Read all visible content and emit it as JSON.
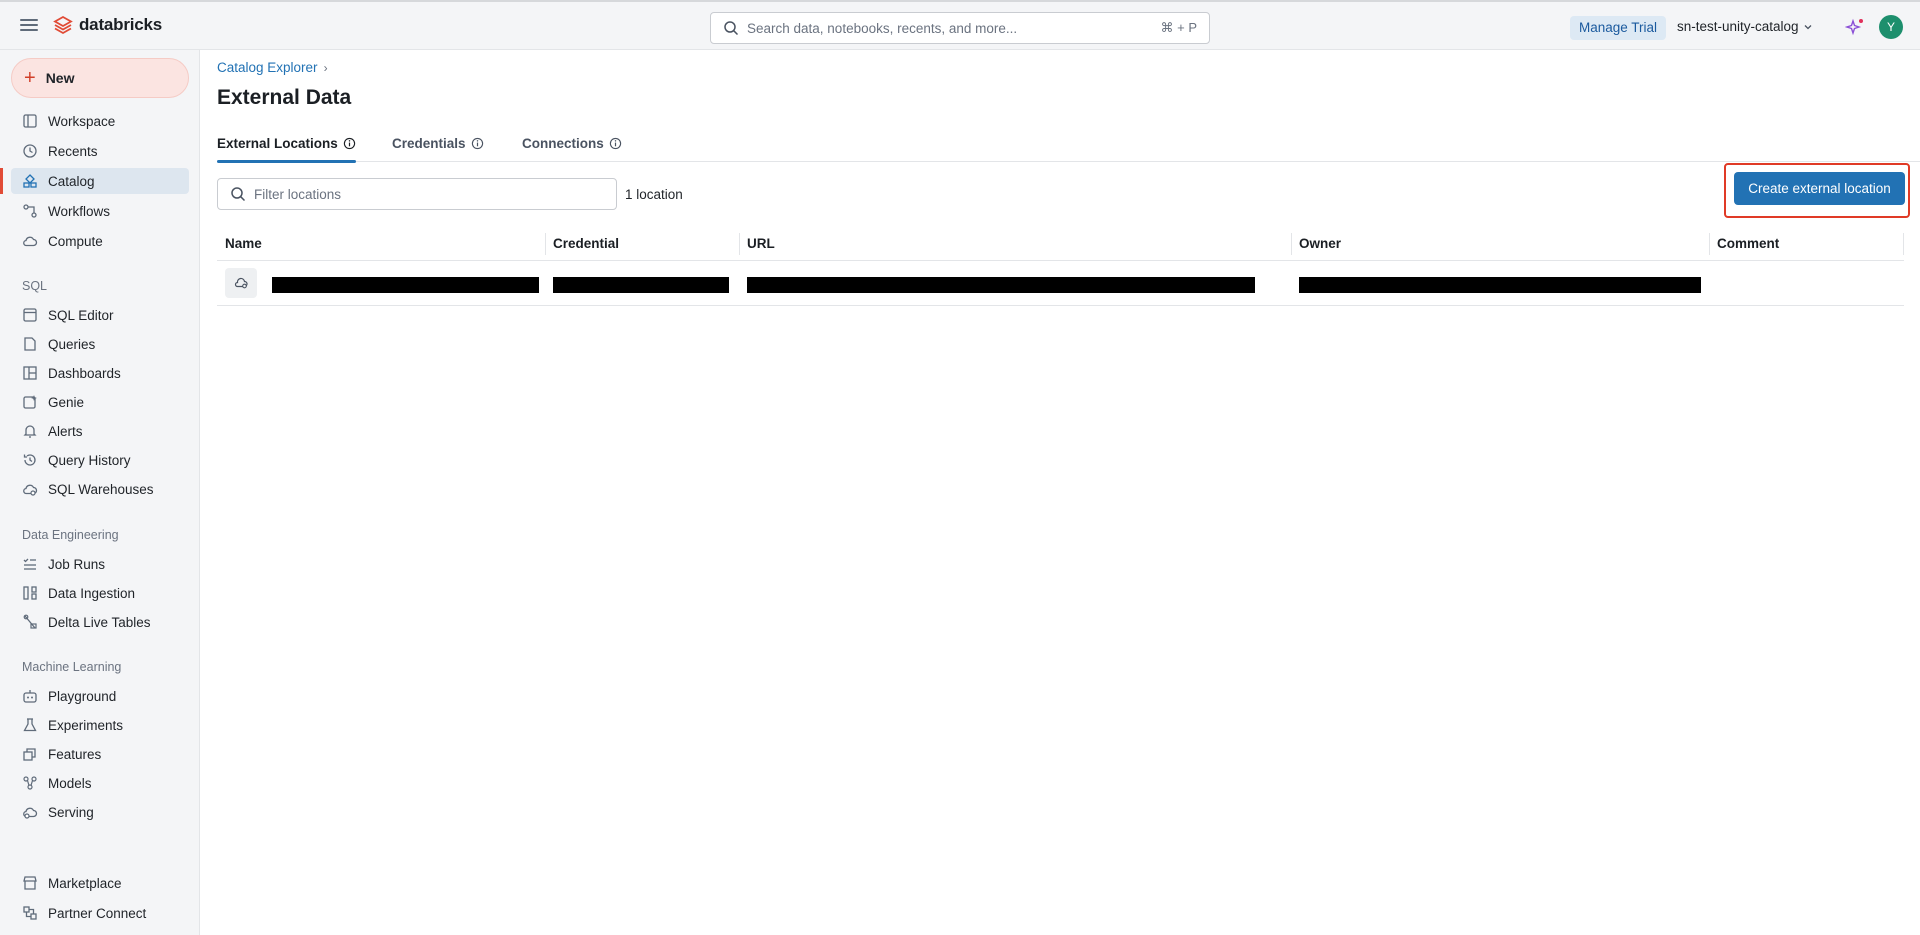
{
  "header": {
    "brand": "databricks",
    "search_placeholder": "Search data, notebooks, recents, and more...",
    "search_shortcut": "⌘ + P",
    "manage_trial": "Manage Trial",
    "workspace": "sn-test-unity-catalog",
    "avatar_initial": "Y"
  },
  "sidebar": {
    "new_label": "New",
    "items": [
      {
        "label": "Workspace",
        "icon": "workspace-icon"
      },
      {
        "label": "Recents",
        "icon": "clock-icon"
      },
      {
        "label": "Catalog",
        "icon": "catalog-icon"
      },
      {
        "label": "Workflows",
        "icon": "workflows-icon"
      },
      {
        "label": "Compute",
        "icon": "cloud-icon"
      }
    ],
    "sql_section": "SQL",
    "sql_items": [
      {
        "label": "SQL Editor",
        "icon": "sql-editor-icon"
      },
      {
        "label": "Queries",
        "icon": "queries-icon"
      },
      {
        "label": "Dashboards",
        "icon": "dashboards-icon"
      },
      {
        "label": "Genie",
        "icon": "genie-icon"
      },
      {
        "label": "Alerts",
        "icon": "bell-icon"
      },
      {
        "label": "Query History",
        "icon": "history-icon"
      },
      {
        "label": "SQL Warehouses",
        "icon": "warehouse-icon"
      }
    ],
    "de_section": "Data Engineering",
    "de_items": [
      {
        "label": "Job Runs",
        "icon": "job-runs-icon"
      },
      {
        "label": "Data Ingestion",
        "icon": "ingestion-icon"
      },
      {
        "label": "Delta Live Tables",
        "icon": "dlt-icon"
      }
    ],
    "ml_section": "Machine Learning",
    "ml_items": [
      {
        "label": "Playground",
        "icon": "playground-icon"
      },
      {
        "label": "Experiments",
        "icon": "experiments-icon"
      },
      {
        "label": "Features",
        "icon": "features-icon"
      },
      {
        "label": "Models",
        "icon": "models-icon"
      },
      {
        "label": "Serving",
        "icon": "serving-icon"
      }
    ],
    "bottom_items": [
      {
        "label": "Marketplace",
        "icon": "marketplace-icon"
      },
      {
        "label": "Partner Connect",
        "icon": "partner-icon"
      }
    ]
  },
  "main": {
    "breadcrumb": "Catalog Explorer",
    "title": "External Data",
    "tabs": [
      {
        "label": "External Locations"
      },
      {
        "label": "Credentials"
      },
      {
        "label": "Connections"
      }
    ],
    "filter_placeholder": "Filter locations",
    "count": "1 location",
    "create_button": "Create external location",
    "table": {
      "columns": [
        "Name",
        "Credential",
        "URL",
        "Owner",
        "Comment"
      ]
    }
  },
  "colors": {
    "accent": "#2272b4",
    "brand": "#e14b36",
    "highlight": "#e03a26"
  }
}
